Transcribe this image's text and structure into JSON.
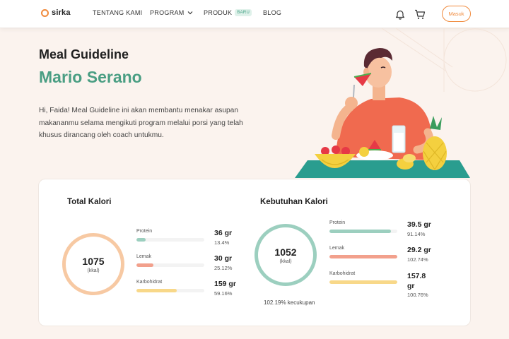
{
  "nav": {
    "logo": "sirka",
    "items": [
      {
        "label": "TENTANG KAMI"
      },
      {
        "label": "PROGRAM"
      },
      {
        "label": "PRODUK",
        "badge": "BARU"
      },
      {
        "label": "BLOG"
      }
    ],
    "icons": [
      "bell-icon",
      "cart-icon"
    ],
    "login_label": "Masuk"
  },
  "hero": {
    "title": "Meal Guideline",
    "name": "Mario Serano",
    "description": "Hi, Faida! Meal Guideline ini akan membantu menakar asupan makananmu selama mengikuti program melalui porsi yang telah khusus dirancang oleh coach untukmu."
  },
  "total": {
    "title": "Total Kalori",
    "value": "1075",
    "unit": "(kkal)",
    "ring_color": "#f7c9a3",
    "nutrients": [
      {
        "label": "Protein",
        "amount": "36 gr",
        "pct": "13.4%",
        "fill": 0.134,
        "color": "#9ccfbf"
      },
      {
        "label": "Lemak",
        "amount": "30 gr",
        "pct": "25.12%",
        "fill": 0.2512,
        "color": "#f2a08c"
      },
      {
        "label": "Karbohidrat",
        "amount": "159 gr",
        "pct": "59.16%",
        "fill": 0.5916,
        "color": "#f8d889"
      }
    ]
  },
  "needs": {
    "title": "Kebutuhan Kalori",
    "value": "1052",
    "unit": "(kkal)",
    "ring_color": "#9ccfbf",
    "coverage": "102.19% kecukupan",
    "nutrients": [
      {
        "label": "Protein",
        "amount": "39.5 gr",
        "pct": "91.14%",
        "fill": 0.9114,
        "color": "#9ccfbf"
      },
      {
        "label": "Lemak",
        "amount": "29.2 gr",
        "pct": "102.74%",
        "fill": 1.0,
        "color": "#f2a08c"
      },
      {
        "label": "Karbohidrat",
        "amount": "157.8 gr",
        "pct": "100.76%",
        "fill": 1.0,
        "color": "#f8d889"
      }
    ]
  }
}
